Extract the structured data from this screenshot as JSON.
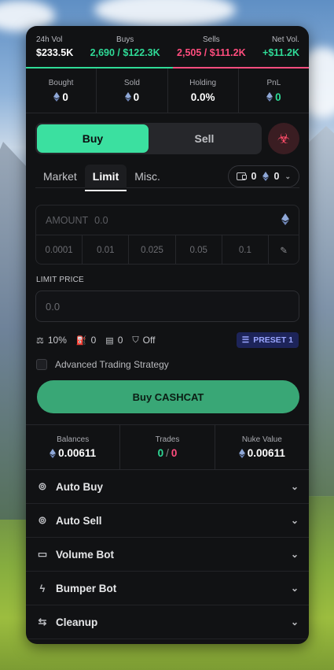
{
  "stats": {
    "vol_label": "24h Vol",
    "vol_value": "$233.5K",
    "buys_label": "Buys",
    "buys_value": "2,690 / $122.3K",
    "sells_label": "Sells",
    "sells_value": "2,505 / $111.2K",
    "net_label": "Net Vol.",
    "net_value": "+$11.2K"
  },
  "position": {
    "bought_label": "Bought",
    "bought_value": "0",
    "sold_label": "Sold",
    "sold_value": "0",
    "holding_label": "Holding",
    "holding_value": "0.0%",
    "pnl_label": "PnL",
    "pnl_value": "0"
  },
  "trade": {
    "buy_label": "Buy",
    "sell_label": "Sell"
  },
  "tabs": [
    {
      "label": "Market"
    },
    {
      "label": "Limit"
    },
    {
      "label": "Misc."
    }
  ],
  "wallet": {
    "count": "0",
    "eth": "0"
  },
  "amount": {
    "label": "AMOUNT",
    "placeholder": "0.0"
  },
  "presets": [
    "0.0001",
    "0.01",
    "0.025",
    "0.05",
    "0.1"
  ],
  "limit": {
    "label": "LIMIT PRICE",
    "placeholder": "0.0"
  },
  "options": {
    "slippage": "10%",
    "gas": "0",
    "priority": "0",
    "mev": "Off",
    "preset": "PRESET 1"
  },
  "ats_label": "Advanced Trading Strategy",
  "buy_button": "Buy CASHCAT",
  "balances": {
    "balances_label": "Balances",
    "balances_value": "0.00611",
    "trades_label": "Trades",
    "trades_buys": "0",
    "trades_sep": "/",
    "trades_sells": "0",
    "nuke_label": "Nuke Value",
    "nuke_value": "0.00611"
  },
  "sections": [
    {
      "label": "Auto Buy",
      "icon": "robot-icon"
    },
    {
      "label": "Auto Sell",
      "icon": "robot-icon"
    },
    {
      "label": "Volume Bot",
      "icon": "chart-icon"
    },
    {
      "label": "Bumper Bot",
      "icon": "bolt-icon"
    },
    {
      "label": "Cleanup",
      "icon": "arrows-icon"
    }
  ],
  "colors": {
    "accent": "#3be0a0",
    "buy": "#2fdb97",
    "sell": "#ff4d7e",
    "buy_button": "#39a776"
  }
}
